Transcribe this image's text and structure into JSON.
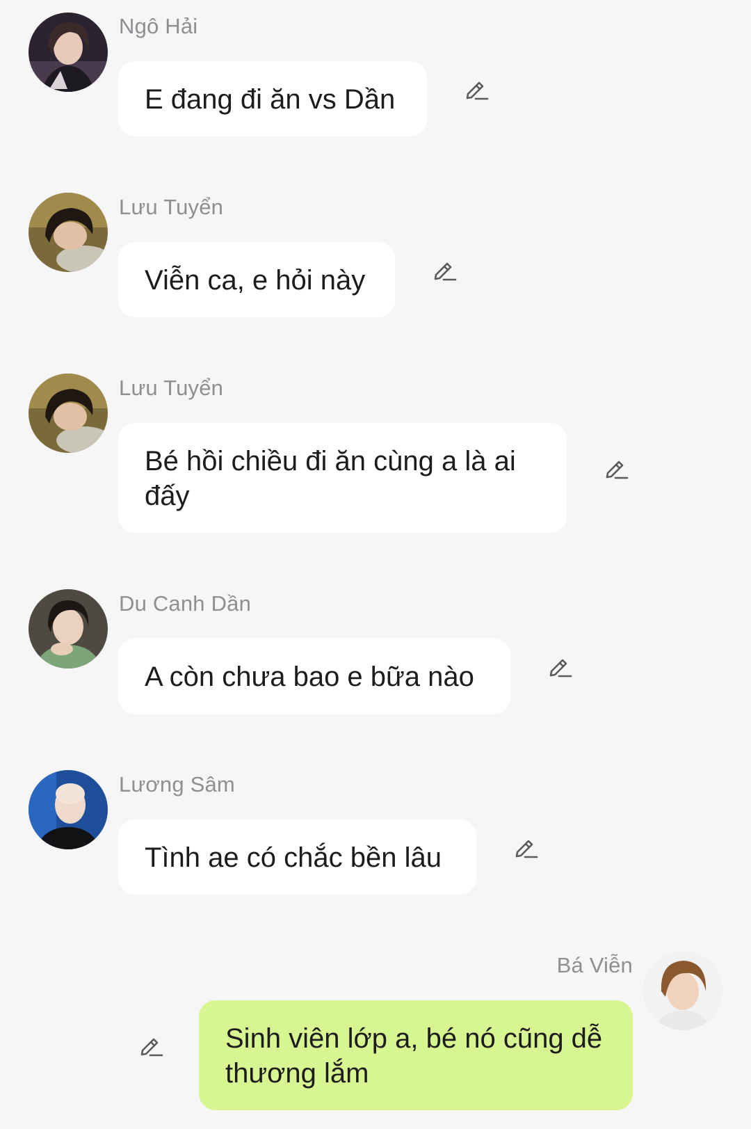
{
  "messages": [
    {
      "sender": "Ngô Hải",
      "text": "E đang đi ăn vs Dần",
      "avatar_icon": "avatar-ngo-hai",
      "edit_icon": "pencil-icon"
    },
    {
      "sender": "Lưu Tuyển",
      "text": "Viễn ca, e hỏi này",
      "avatar_icon": "avatar-luu-tuyen",
      "edit_icon": "pencil-icon"
    },
    {
      "sender": "Lưu Tuyển",
      "text": "Bé hồi chiều đi ăn cùng a là ai đấy",
      "avatar_icon": "avatar-luu-tuyen",
      "edit_icon": "pencil-icon"
    },
    {
      "sender": "Du Canh Dần",
      "text": "A còn chưa bao e bữa nào",
      "avatar_icon": "avatar-du-canh-dan",
      "edit_icon": "pencil-icon"
    },
    {
      "sender": "Lương Sâm",
      "text": "Tình ae có chắc bền lâu",
      "avatar_icon": "avatar-luong-sam",
      "edit_icon": "pencil-icon"
    },
    {
      "sender": "Bá Viễn",
      "text": "Sinh viên lớp a, bé nó cũng dễ thương lắm",
      "avatar_icon": "avatar-ba-vien",
      "edit_icon": "pencil-icon",
      "own": true
    }
  ],
  "colors": {
    "background": "#f6f6f7",
    "incoming_bubble": "#ffffff",
    "outgoing_bubble": "#d7f590",
    "sender_name": "#8e8e93",
    "message_text": "#1c1c1e",
    "edit_icon": "#5a5a5e"
  }
}
